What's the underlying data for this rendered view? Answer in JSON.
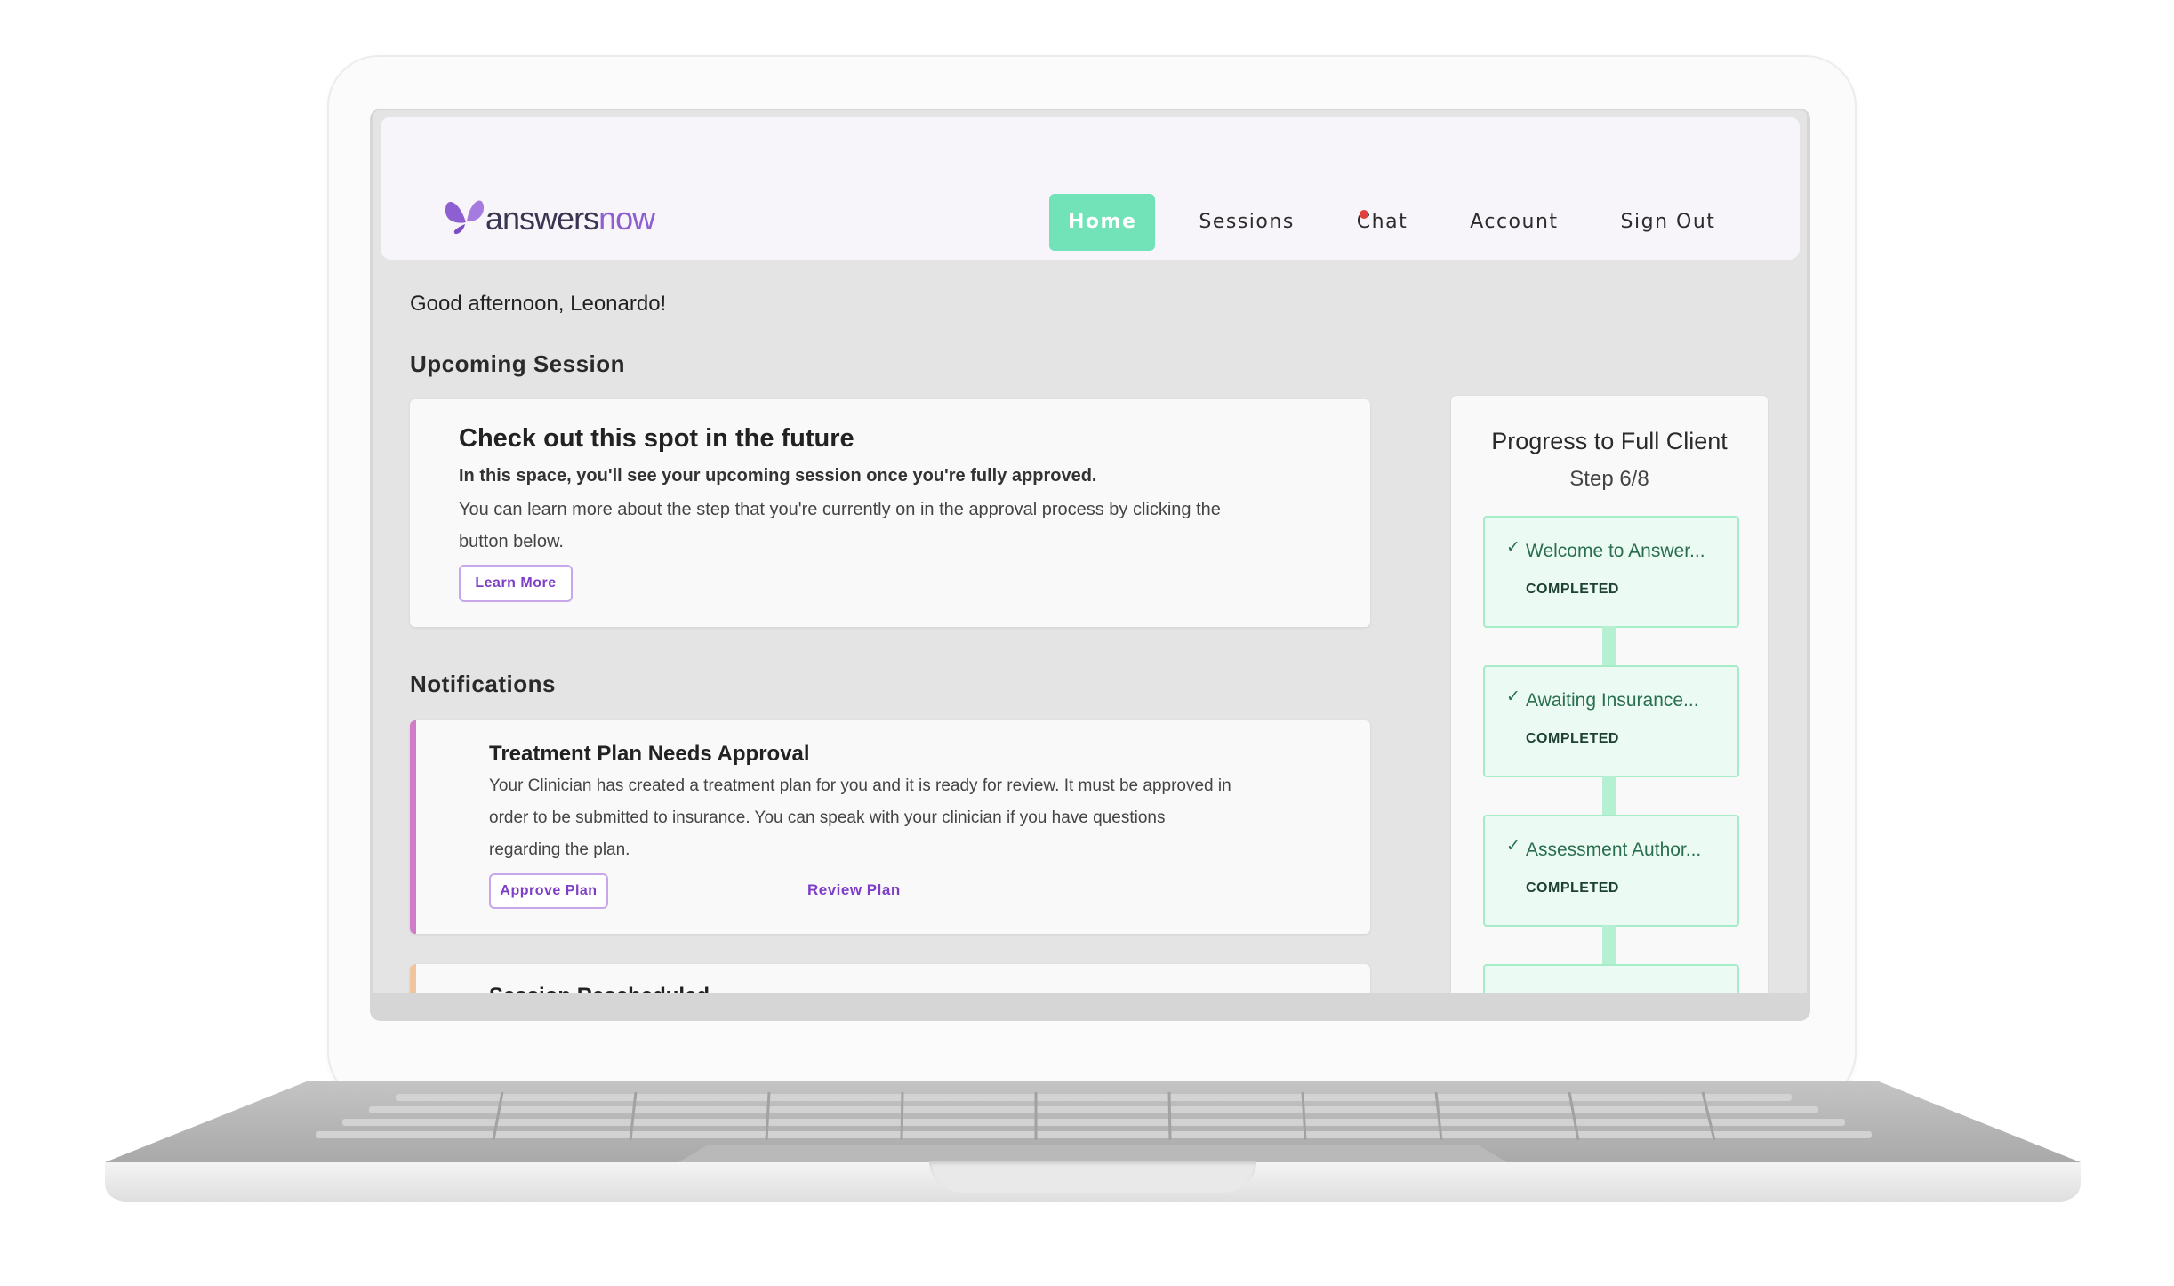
{
  "header": {
    "logo_part1": "answers",
    "logo_part2": "now",
    "nav": [
      {
        "label": "Home",
        "active": true
      },
      {
        "label": "Sessions"
      },
      {
        "label": "Chat",
        "has_notification_dot": true
      },
      {
        "label": "Account"
      },
      {
        "label": "Sign Out"
      }
    ]
  },
  "greeting": "Good afternoon, Leonardo!",
  "upcoming": {
    "heading": "Upcoming Session",
    "card_title": "Check out this spot in the future",
    "card_subtitle": "In this space, you'll see your upcoming session once you're fully approved.",
    "card_body_line1": "You can learn more about the step that you're currently on in the approval process by clicking the",
    "card_body_line2": "button below.",
    "button": "Learn More"
  },
  "notifications": {
    "heading": "Notifications",
    "items": [
      {
        "title": "Treatment Plan Needs Approval",
        "line1": "Your Clinician has created a treatment plan for you and it is ready for review. It must be approved in",
        "line2": "order to be submitted to insurance. You can speak with your clinician if you have questions",
        "line3": "regarding the plan.",
        "primary": "Approve Plan",
        "secondary": "Review Plan",
        "accent": "#d07cc8"
      },
      {
        "title": "Session Rescheduled",
        "accent": "#f0c49e"
      }
    ]
  },
  "progress": {
    "title": "Progress to Full Client",
    "step": "Step 6/8",
    "steps": [
      {
        "name": "Welcome to Answer...",
        "status": "COMPLETED"
      },
      {
        "name": "Awaiting Insurance...",
        "status": "COMPLETED"
      },
      {
        "name": "Assessment Author...",
        "status": "COMPLETED"
      }
    ]
  },
  "colors": {
    "brand_purple": "#8d5fd0",
    "nav_active": "#72e3b8",
    "step_border": "#a7ecc9"
  }
}
